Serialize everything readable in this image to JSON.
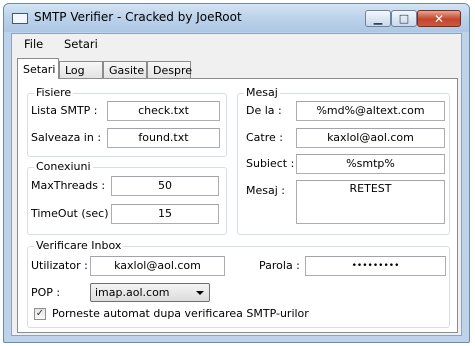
{
  "window": {
    "title": "SMTP Verifier - Cracked by JoeRoot"
  },
  "titlebar": {
    "minimize": "▁",
    "maximize": "□",
    "close": "✕"
  },
  "menu": {
    "file": "File",
    "settings": "Setari"
  },
  "tabs": [
    "Setari",
    "Log",
    "Gasite",
    "Despre"
  ],
  "fisiere": {
    "title": "Fisiere",
    "list_label": "Lista SMTP :",
    "list_value": "check.txt",
    "save_label": "Salveaza in :",
    "save_value": "found.txt"
  },
  "conexiuni": {
    "title": "Conexiuni",
    "threads_label": "MaxThreads :",
    "threads_value": "50",
    "timeout_label": "TimeOut (sec) :",
    "timeout_value": "15"
  },
  "mesaj": {
    "title": "Mesaj",
    "from_label": "De la :",
    "from_value": "%md%@altext.com",
    "to_label": "Catre :",
    "to_value": "kaxlol@aol.com",
    "subject_label": "Subiect :",
    "subject_value": "%smtp%",
    "body_label": "Mesaj :",
    "body_value": "RETEST"
  },
  "inbox": {
    "title": "Verificare Inbox",
    "user_label": "Utilizator :",
    "user_value": "kaxlol@aol.com",
    "pass_label": "Parola :",
    "pass_value": "•••••••••",
    "pop_label": "POP :",
    "pop_value": "imap.aol.com",
    "autostart_label": "Porneste automat dupa verificarea SMTP-urilor",
    "autostart_checked": true
  }
}
